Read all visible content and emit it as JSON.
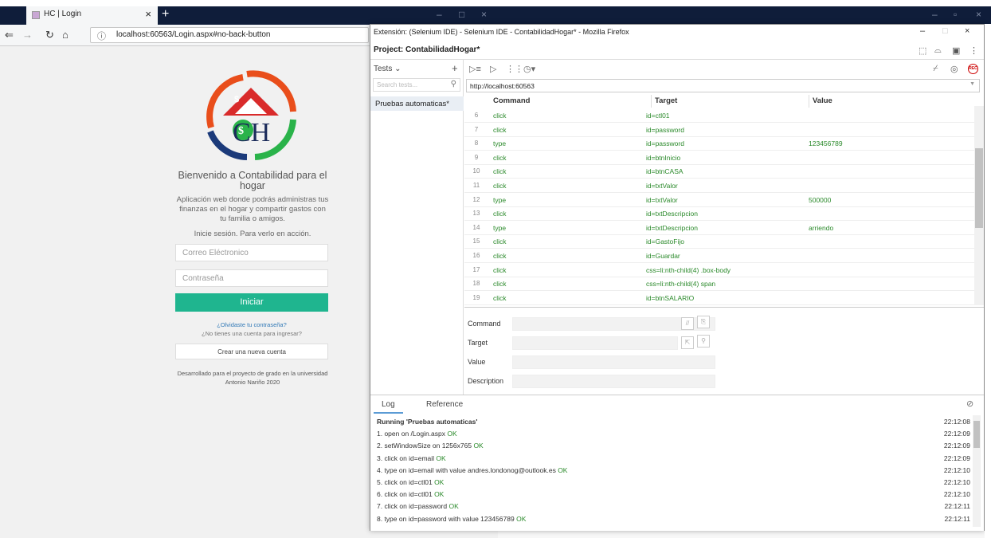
{
  "browser": {
    "tab_title": "HC | Login",
    "url": "localhost:60563/Login.aspx#no-back-button"
  },
  "login": {
    "welcome": "Bienvenido a Contabilidad para el hogar",
    "description": "Aplicación web donde podrás administras tus finanzas en el hogar y compartir gastos con tu familia o amigos.",
    "subtitle": "Inicie sesión. Para verlo en acción.",
    "email_placeholder": "Correo Eléctronico",
    "password_placeholder": "Contraseña",
    "login_button": "Iniciar",
    "forgot": "¿Olvidaste tu contraseña?",
    "no_account": "¿No tienes una cuenta para ingresar?",
    "create_account": "Crear una nueva cuenta",
    "footer": "Desarrollado para el proyecto de grado en la universidad Antonio Nariño 2020",
    "logo_text": "CH"
  },
  "selenium": {
    "window_title": "Extensión: (Selenium IDE) - Selenium IDE - ContabilidadHogar* - Mozilla Firefox",
    "project": "Project:  ContabilidadHogar*",
    "tests_label": "Tests",
    "search_placeholder": "Search tests...",
    "suite": "Pruebas automaticas*",
    "base_url": "http://localhost:60563",
    "columns": {
      "command": "Command",
      "target": "Target",
      "value": "Value"
    },
    "rows": [
      {
        "n": "6",
        "command": "click",
        "target": "id=ctl01",
        "value": ""
      },
      {
        "n": "7",
        "command": "click",
        "target": "id=password",
        "value": ""
      },
      {
        "n": "8",
        "command": "type",
        "target": "id=password",
        "value": "123456789"
      },
      {
        "n": "9",
        "command": "click",
        "target": "id=btnInicio",
        "value": ""
      },
      {
        "n": "10",
        "command": "click",
        "target": "id=btnCASA",
        "value": ""
      },
      {
        "n": "11",
        "command": "click",
        "target": "id=txtValor",
        "value": ""
      },
      {
        "n": "12",
        "command": "type",
        "target": "id=txtValor",
        "value": "500000"
      },
      {
        "n": "13",
        "command": "click",
        "target": "id=txtDescripcion",
        "value": ""
      },
      {
        "n": "14",
        "command": "type",
        "target": "id=txtDescripcion",
        "value": "arriendo"
      },
      {
        "n": "15",
        "command": "click",
        "target": "id=GastoFijo",
        "value": ""
      },
      {
        "n": "16",
        "command": "click",
        "target": "id=Guardar",
        "value": ""
      },
      {
        "n": "17",
        "command": "click",
        "target": "css=li:nth-child(4) .box-body",
        "value": ""
      },
      {
        "n": "18",
        "command": "click",
        "target": "css=li:nth-child(4) span",
        "value": ""
      },
      {
        "n": "19",
        "command": "click",
        "target": "id=btnSALARIO",
        "value": ""
      }
    ],
    "editor": {
      "command": "Command",
      "target": "Target",
      "value": "Value",
      "description": "Description"
    },
    "log_tab": "Log",
    "reference_tab": "Reference",
    "log": [
      {
        "text": "Running 'Pruebas automaticas'",
        "ok": "",
        "time": "22:12:08",
        "bold": true
      },
      {
        "text": "1.  open on /Login.aspx",
        "ok": "OK",
        "time": "22:12:09"
      },
      {
        "text": "2.  setWindowSize on 1256x765",
        "ok": "OK",
        "time": "22:12:09"
      },
      {
        "text": "3.  click on id=email",
        "ok": "OK",
        "time": "22:12:09"
      },
      {
        "text": "4.  type on id=email with value andres.londonog@outlook.es",
        "ok": "OK",
        "time": "22:12:10"
      },
      {
        "text": "5.  click on id=ctl01",
        "ok": "OK",
        "time": "22:12:10"
      },
      {
        "text": "6.  click on id=ctl01",
        "ok": "OK",
        "time": "22:12:10"
      },
      {
        "text": "7.  click on id=password",
        "ok": "OK",
        "time": "22:12:11"
      },
      {
        "text": "8.  type on id=password with value 123456789",
        "ok": "OK",
        "time": "22:12:11"
      }
    ]
  }
}
